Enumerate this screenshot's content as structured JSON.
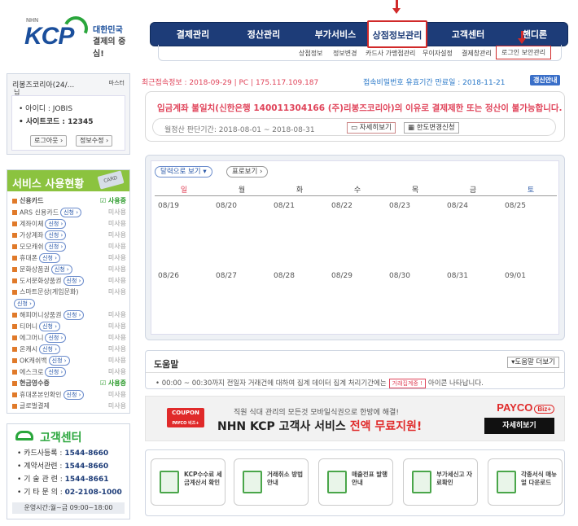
{
  "logo": {
    "nhn": "NHN",
    "kcp": "KCP",
    "slogan1": "대한민국",
    "slogan2": "결제의 중심!"
  },
  "nav": {
    "items": [
      {
        "label": "결제관리"
      },
      {
        "label": "정산관리"
      },
      {
        "label": "부가서비스"
      },
      {
        "label": "상점정보관리"
      },
      {
        "label": "고객센터"
      },
      {
        "label": "핸디론"
      }
    ],
    "active_index": 3
  },
  "subnav": {
    "items": [
      "상점정보",
      "정보변경",
      "카드사 가맹점관리",
      "무이자설정",
      "결제창관리",
      "로그인 보안관리"
    ]
  },
  "member": {
    "name": "리봉즈코리아(24/...",
    "name2": "님",
    "level": "마스터",
    "id_label": "• 아이디 : JOBIS",
    "site_label": "• 사이트코드 : 12345",
    "logout": "로그아웃 ›",
    "edit": "정보수정 ›"
  },
  "service": {
    "title": "서비스 사용현황",
    "card_badge": "CARD",
    "rows": [
      {
        "name": "신용카드",
        "apply": "",
        "status": "☑ 사용중",
        "on": true
      },
      {
        "name": "ARS 신용카드",
        "apply": "신청 ›",
        "status": "미사용",
        "on": false
      },
      {
        "name": "계좌이체",
        "apply": "신청 ›",
        "status": "미사용",
        "on": false
      },
      {
        "name": "가상계좌",
        "apply": "신청 ›",
        "status": "미사용",
        "on": false
      },
      {
        "name": "모모캐쉬",
        "apply": "신청 ›",
        "status": "미사용",
        "on": false
      },
      {
        "name": "휴대폰",
        "apply": "신청 ›",
        "status": "미사용",
        "on": false
      },
      {
        "name": "문화상품권",
        "apply": "신청 ›",
        "status": "미사용",
        "on": false
      },
      {
        "name": "도서문화상품권",
        "apply": "신청 ›",
        "status": "미사용",
        "on": false
      },
      {
        "name": "스마트문상(게임문화)",
        "apply": "",
        "status": "미사용",
        "on": false
      },
      {
        "name": "",
        "apply": "신청 ›",
        "status": "",
        "on": false
      },
      {
        "name": "해피머니상품권",
        "apply": "신청 ›",
        "status": "미사용",
        "on": false
      },
      {
        "name": "티머니",
        "apply": "신청 ›",
        "status": "미사용",
        "on": false
      },
      {
        "name": "에그머니",
        "apply": "신청 ›",
        "status": "미사용",
        "on": false
      },
      {
        "name": "온캐시",
        "apply": "신청 ›",
        "status": "미사용",
        "on": false
      },
      {
        "name": "OK캐쉬백",
        "apply": "신청 ›",
        "status": "미사용",
        "on": false
      },
      {
        "name": "에스크로",
        "apply": "신청 ›",
        "status": "미사용",
        "on": false
      },
      {
        "name": "현금영수증",
        "apply": "",
        "status": "☑ 사용중",
        "on": true
      },
      {
        "name": "휴대폰본인확인",
        "apply": "신청 ›",
        "status": "미사용",
        "on": false
      },
      {
        "name": "글로벌결제",
        "apply": "",
        "status": "미사용",
        "on": false
      }
    ]
  },
  "cs": {
    "title": "고객센터",
    "rows": [
      {
        "k": "• 카드사등록 : ",
        "v": "1544-8660"
      },
      {
        "k": "• 계약서관련 : ",
        "v": "1544-8660"
      },
      {
        "k": "• 기 술 관 련 : ",
        "v": "1544-8661"
      },
      {
        "k": "• 기 타 문 의 : ",
        "v": "02-2108-1000"
      }
    ],
    "hours": "운영시간:월~금 09:00~18:00"
  },
  "status": {
    "last_login": "최근접속정보 : 2018-09-29 | PC | 175.117.109.187",
    "pwd_expiry": "접속비밀번호 유효기간 만료일 : 2018-11-21",
    "renew": "갱신안내"
  },
  "notice": {
    "message": "입금계좌 불일치(신한은행 140011304166 (주)리봉즈코리아)의 이유로 결제제한 또는 정산이 불가능합니다.",
    "period": "월정산 판단기간: 2018-08-01 ~ 2018-08-31",
    "detail_btn": "▭ 자세히보기",
    "limit_btn": "▦ 한도변경신청"
  },
  "calendar": {
    "view_calendar": "달력으로 보기 ▾",
    "view_table": "표로보기 ›",
    "days": [
      {
        "label": "일",
        "color": "#e0445a"
      },
      {
        "label": "월",
        "color": "#444"
      },
      {
        "label": "화",
        "color": "#444"
      },
      {
        "label": "수",
        "color": "#444"
      },
      {
        "label": "목",
        "color": "#444"
      },
      {
        "label": "금",
        "color": "#444"
      },
      {
        "label": "토",
        "color": "#2a58a8"
      }
    ],
    "week1": [
      "08/19",
      "08/20",
      "08/21",
      "08/22",
      "08/23",
      "08/24",
      "08/25"
    ],
    "week2": [
      "08/26",
      "08/27",
      "08/28",
      "08/29",
      "08/30",
      "08/31",
      "09/01"
    ]
  },
  "help": {
    "title": "도움말",
    "more": "▾도움말 더보기",
    "text_before": "• 00:00 ~ 00:30까지 전일자 거래건에 대하여 집계 데이터 집계 처리기간에는",
    "tag": "거래집계중 !",
    "text_after": "아이콘 나타납니다."
  },
  "banner": {
    "coupon": "COUPON",
    "coupon2": "PAYCO 비즈+",
    "line1": "직원 식대 관리의 모든것 모바일식권으로 한방에 해결!",
    "line2a": "NHN KCP 고객사 서비스 ",
    "line2b": "전액 무료지원!",
    "payco": "PAYCO",
    "biz": "Biz+",
    "view": "자세히보기"
  },
  "quick": [
    {
      "label": "KCP수수료 세금계산서 확인"
    },
    {
      "label": "거래취소 방법안내"
    },
    {
      "label": "매출전표 발행안내"
    },
    {
      "label": "부가세신고 자료확인"
    },
    {
      "label": "각종서식 매뉴얼 다운로드"
    }
  ]
}
